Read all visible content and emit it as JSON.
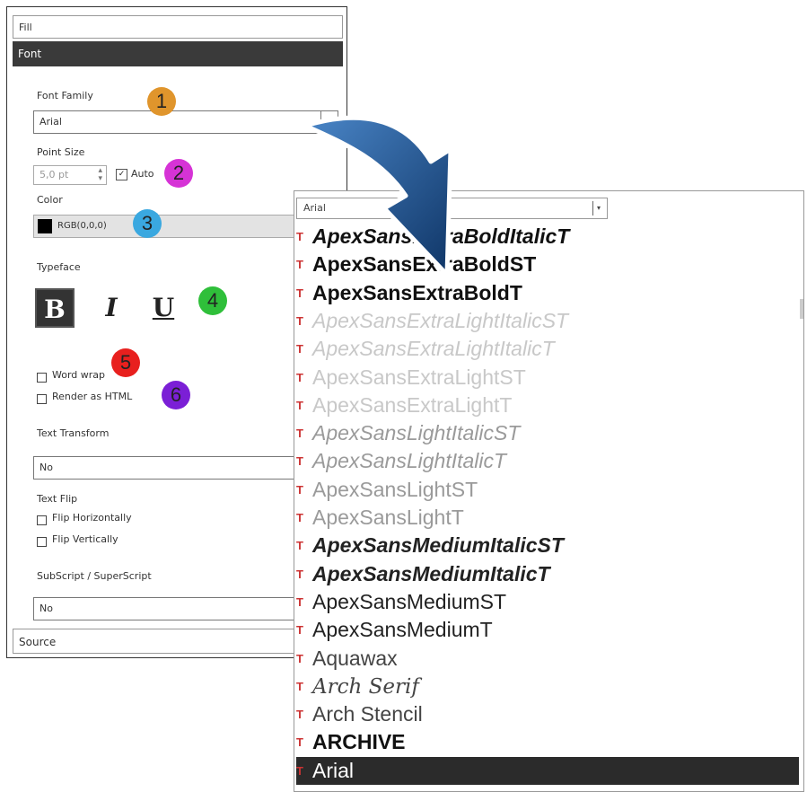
{
  "panel": {
    "fill_label": "Fill",
    "font_label": "Font",
    "source_label": "Source",
    "font_family": {
      "label": "Font Family",
      "value": "Arial"
    },
    "point_size": {
      "label": "Point Size",
      "value": "5,0 pt",
      "auto_label": "Auto",
      "auto_checked": true
    },
    "color": {
      "label": "Color",
      "value": "RGB(0,0,0)",
      "swatch": "#000000"
    },
    "typeface": {
      "label": "Typeface",
      "bold": "B",
      "italic": "I",
      "underline": "U"
    },
    "word_wrap_label": "Word wrap",
    "render_html_label": "Render as HTML",
    "text_transform": {
      "label": "Text Transform",
      "value": "No"
    },
    "text_flip": {
      "label": "Text Flip",
      "flip_h": "Flip Horizontally",
      "flip_v": "Flip Vertically"
    },
    "subsuper": {
      "label": "SubScript / SuperScript",
      "value": "No"
    }
  },
  "badges": [
    {
      "text": "1",
      "color": "#e0952c"
    },
    {
      "text": "2",
      "color": "#d633d6"
    },
    {
      "text": "3",
      "color": "#3aa8e0"
    },
    {
      "text": "4",
      "color": "#2fbf3a"
    },
    {
      "text": "5",
      "color": "#e8201e"
    },
    {
      "text": "6",
      "color": "#7b1fd6"
    }
  ],
  "dropdown": {
    "selected_value": "Arial",
    "items": [
      {
        "label": "ApexSansExtraBoldItalicT",
        "weight": "bold",
        "style": "italic",
        "tone": "#111111"
      },
      {
        "label": "ApexSansExtraBoldST",
        "weight": "bold",
        "style": "normal",
        "tone": "#111111"
      },
      {
        "label": "ApexSansExtraBoldT",
        "weight": "bold",
        "style": "normal",
        "tone": "#111111"
      },
      {
        "label": "ApexSansExtraLightItalicST",
        "weight": "normal",
        "style": "italic",
        "tone": "#c8c8c8"
      },
      {
        "label": "ApexSansExtraLightItalicT",
        "weight": "normal",
        "style": "italic",
        "tone": "#c8c8c8"
      },
      {
        "label": "ApexSansExtraLightST",
        "weight": "normal",
        "style": "normal",
        "tone": "#c8c8c8"
      },
      {
        "label": "ApexSansExtraLightT",
        "weight": "normal",
        "style": "normal",
        "tone": "#c8c8c8"
      },
      {
        "label": "ApexSansLightItalicST",
        "weight": "normal",
        "style": "italic",
        "tone": "#9a9a9a"
      },
      {
        "label": "ApexSansLightItalicT",
        "weight": "normal",
        "style": "italic",
        "tone": "#9a9a9a"
      },
      {
        "label": "ApexSansLightST",
        "weight": "normal",
        "style": "normal",
        "tone": "#9a9a9a"
      },
      {
        "label": "ApexSansLightT",
        "weight": "normal",
        "style": "normal",
        "tone": "#9a9a9a"
      },
      {
        "label": "ApexSansMediumItalicST",
        "weight": "bold",
        "style": "italic",
        "tone": "#222222"
      },
      {
        "label": "ApexSansMediumItalicT",
        "weight": "bold",
        "style": "italic",
        "tone": "#222222"
      },
      {
        "label": "ApexSansMediumST",
        "weight": "normal",
        "style": "normal",
        "tone": "#222222"
      },
      {
        "label": "ApexSansMediumT",
        "weight": "normal",
        "style": "normal",
        "tone": "#222222"
      },
      {
        "label": "Aquawax",
        "weight": "normal",
        "style": "normal",
        "tone": "#444444"
      },
      {
        "label": "Arch Serif",
        "weight": "normal",
        "style": "italic",
        "tone": "#444444",
        "serif": true
      },
      {
        "label": "Arch Stencil",
        "weight": "normal",
        "style": "normal",
        "tone": "#444444"
      },
      {
        "label": "ARCHIVE",
        "weight": "bold",
        "style": "normal",
        "tone": "#111111"
      },
      {
        "label": "Arial",
        "weight": "normal",
        "style": "normal",
        "tone": "#ffffff",
        "selected": true
      }
    ]
  }
}
